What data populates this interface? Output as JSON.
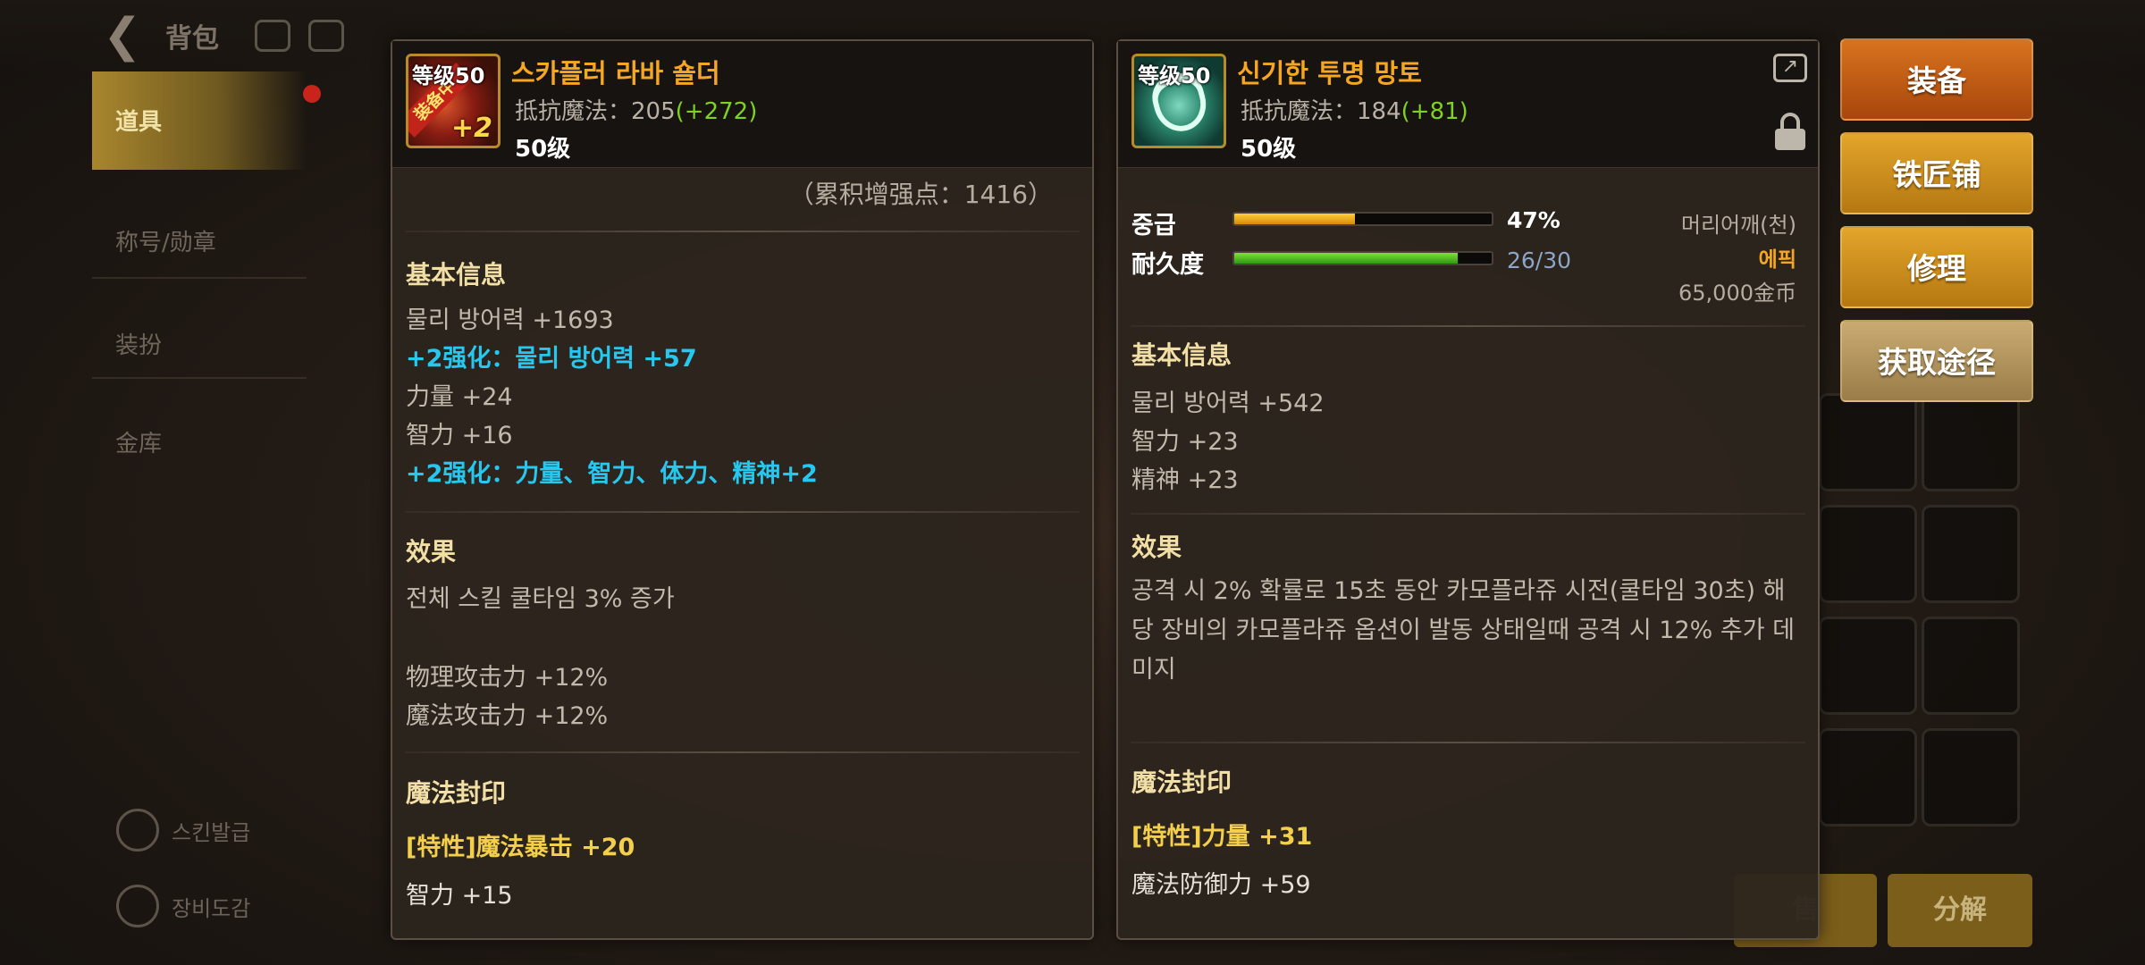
{
  "background": {
    "title": "背包",
    "tabs": [
      {
        "label": "道具"
      },
      {
        "label": "称号/勋章"
      },
      {
        "label": "装扮"
      },
      {
        "label": "金库"
      }
    ],
    "bottom_links": [
      {
        "label": "스킨발급"
      },
      {
        "label": "장비도감"
      }
    ],
    "bottom_buttons": [
      {
        "label": "售"
      },
      {
        "label": "分解"
      }
    ]
  },
  "left_item": {
    "name": "스카플러 라바 숄더",
    "icon_level": "等级50",
    "icon_plus": "+2",
    "icon_ribbon": "装备中",
    "stat_label": "抵抗魔法：205",
    "stat_bonus": "(+272)",
    "level": "50级",
    "cumulative": "（累积增强点：1416）",
    "basic_title": "基本信息",
    "basic_lines": [
      "물리 방어력 +1693",
      "+2强化：물리 방어력 +57",
      "力量 +24",
      "智力 +16",
      "+2强化：力量、智力、体力、精神+2"
    ],
    "effect_title": "效果",
    "effect_lines": [
      "전체 스킬 쿨타임 3% 증가",
      "物理攻击力 +12%",
      "魔法攻击力 +12%"
    ],
    "seal_title": "魔法封印",
    "seal_lines": [
      "[特性]魔法暴击 +20",
      "智力 +15"
    ]
  },
  "right_item": {
    "name": "신기한 투명 망토",
    "icon_level": "等级50",
    "stat_label": "抵抗魔法：184",
    "stat_bonus": "(+81)",
    "level": "50级",
    "grade_label": "중급",
    "grade_percent": 47,
    "grade_text": "47%",
    "durability_label": "耐久度",
    "durability_current": 26,
    "durability_max": 30,
    "durability_text": "26/30",
    "slot": "머리어깨(천)",
    "rarity": "에픽",
    "price": "65,000金币",
    "basic_title": "基本信息",
    "basic_lines": [
      "물리 방어력 +542",
      "智力 +23",
      "精神 +23"
    ],
    "effect_title": "效果",
    "effect_text": "공격 시 2% 확률로 15초 동안 카모플라쥬 시전(쿨타임 30초) 해당 장비의 카모플라쥬 옵션이 발동 상태일때 공격 시 12% 추가 데미지",
    "seal_title": "魔法封印",
    "seal_lines": [
      "[特性]力量 +31",
      "魔法防御力 +59"
    ]
  },
  "actions": {
    "equip": "装备",
    "blacksmith": "铁匠铺",
    "repair": "修理",
    "source": "获取途径"
  },
  "colors": {
    "item_name": "#f5a623",
    "bonus": "#7ed321",
    "enhance": "#26c8f0",
    "seal_trait": "#f3cf4b"
  }
}
